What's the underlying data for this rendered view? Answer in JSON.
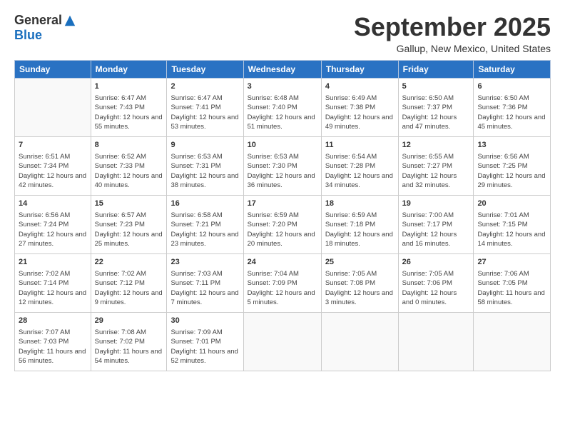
{
  "logo": {
    "general": "General",
    "blue": "Blue"
  },
  "title": "September 2025",
  "location": "Gallup, New Mexico, United States",
  "days_of_week": [
    "Sunday",
    "Monday",
    "Tuesday",
    "Wednesday",
    "Thursday",
    "Friday",
    "Saturday"
  ],
  "weeks": [
    [
      {
        "day": "",
        "sunrise": "",
        "sunset": "",
        "daylight": ""
      },
      {
        "day": "1",
        "sunrise": "Sunrise: 6:47 AM",
        "sunset": "Sunset: 7:43 PM",
        "daylight": "Daylight: 12 hours and 55 minutes."
      },
      {
        "day": "2",
        "sunrise": "Sunrise: 6:47 AM",
        "sunset": "Sunset: 7:41 PM",
        "daylight": "Daylight: 12 hours and 53 minutes."
      },
      {
        "day": "3",
        "sunrise": "Sunrise: 6:48 AM",
        "sunset": "Sunset: 7:40 PM",
        "daylight": "Daylight: 12 hours and 51 minutes."
      },
      {
        "day": "4",
        "sunrise": "Sunrise: 6:49 AM",
        "sunset": "Sunset: 7:38 PM",
        "daylight": "Daylight: 12 hours and 49 minutes."
      },
      {
        "day": "5",
        "sunrise": "Sunrise: 6:50 AM",
        "sunset": "Sunset: 7:37 PM",
        "daylight": "Daylight: 12 hours and 47 minutes."
      },
      {
        "day": "6",
        "sunrise": "Sunrise: 6:50 AM",
        "sunset": "Sunset: 7:36 PM",
        "daylight": "Daylight: 12 hours and 45 minutes."
      }
    ],
    [
      {
        "day": "7",
        "sunrise": "Sunrise: 6:51 AM",
        "sunset": "Sunset: 7:34 PM",
        "daylight": "Daylight: 12 hours and 42 minutes."
      },
      {
        "day": "8",
        "sunrise": "Sunrise: 6:52 AM",
        "sunset": "Sunset: 7:33 PM",
        "daylight": "Daylight: 12 hours and 40 minutes."
      },
      {
        "day": "9",
        "sunrise": "Sunrise: 6:53 AM",
        "sunset": "Sunset: 7:31 PM",
        "daylight": "Daylight: 12 hours and 38 minutes."
      },
      {
        "day": "10",
        "sunrise": "Sunrise: 6:53 AM",
        "sunset": "Sunset: 7:30 PM",
        "daylight": "Daylight: 12 hours and 36 minutes."
      },
      {
        "day": "11",
        "sunrise": "Sunrise: 6:54 AM",
        "sunset": "Sunset: 7:28 PM",
        "daylight": "Daylight: 12 hours and 34 minutes."
      },
      {
        "day": "12",
        "sunrise": "Sunrise: 6:55 AM",
        "sunset": "Sunset: 7:27 PM",
        "daylight": "Daylight: 12 hours and 32 minutes."
      },
      {
        "day": "13",
        "sunrise": "Sunrise: 6:56 AM",
        "sunset": "Sunset: 7:25 PM",
        "daylight": "Daylight: 12 hours and 29 minutes."
      }
    ],
    [
      {
        "day": "14",
        "sunrise": "Sunrise: 6:56 AM",
        "sunset": "Sunset: 7:24 PM",
        "daylight": "Daylight: 12 hours and 27 minutes."
      },
      {
        "day": "15",
        "sunrise": "Sunrise: 6:57 AM",
        "sunset": "Sunset: 7:23 PM",
        "daylight": "Daylight: 12 hours and 25 minutes."
      },
      {
        "day": "16",
        "sunrise": "Sunrise: 6:58 AM",
        "sunset": "Sunset: 7:21 PM",
        "daylight": "Daylight: 12 hours and 23 minutes."
      },
      {
        "day": "17",
        "sunrise": "Sunrise: 6:59 AM",
        "sunset": "Sunset: 7:20 PM",
        "daylight": "Daylight: 12 hours and 20 minutes."
      },
      {
        "day": "18",
        "sunrise": "Sunrise: 6:59 AM",
        "sunset": "Sunset: 7:18 PM",
        "daylight": "Daylight: 12 hours and 18 minutes."
      },
      {
        "day": "19",
        "sunrise": "Sunrise: 7:00 AM",
        "sunset": "Sunset: 7:17 PM",
        "daylight": "Daylight: 12 hours and 16 minutes."
      },
      {
        "day": "20",
        "sunrise": "Sunrise: 7:01 AM",
        "sunset": "Sunset: 7:15 PM",
        "daylight": "Daylight: 12 hours and 14 minutes."
      }
    ],
    [
      {
        "day": "21",
        "sunrise": "Sunrise: 7:02 AM",
        "sunset": "Sunset: 7:14 PM",
        "daylight": "Daylight: 12 hours and 12 minutes."
      },
      {
        "day": "22",
        "sunrise": "Sunrise: 7:02 AM",
        "sunset": "Sunset: 7:12 PM",
        "daylight": "Daylight: 12 hours and 9 minutes."
      },
      {
        "day": "23",
        "sunrise": "Sunrise: 7:03 AM",
        "sunset": "Sunset: 7:11 PM",
        "daylight": "Daylight: 12 hours and 7 minutes."
      },
      {
        "day": "24",
        "sunrise": "Sunrise: 7:04 AM",
        "sunset": "Sunset: 7:09 PM",
        "daylight": "Daylight: 12 hours and 5 minutes."
      },
      {
        "day": "25",
        "sunrise": "Sunrise: 7:05 AM",
        "sunset": "Sunset: 7:08 PM",
        "daylight": "Daylight: 12 hours and 3 minutes."
      },
      {
        "day": "26",
        "sunrise": "Sunrise: 7:05 AM",
        "sunset": "Sunset: 7:06 PM",
        "daylight": "Daylight: 12 hours and 0 minutes."
      },
      {
        "day": "27",
        "sunrise": "Sunrise: 7:06 AM",
        "sunset": "Sunset: 7:05 PM",
        "daylight": "Daylight: 11 hours and 58 minutes."
      }
    ],
    [
      {
        "day": "28",
        "sunrise": "Sunrise: 7:07 AM",
        "sunset": "Sunset: 7:03 PM",
        "daylight": "Daylight: 11 hours and 56 minutes."
      },
      {
        "day": "29",
        "sunrise": "Sunrise: 7:08 AM",
        "sunset": "Sunset: 7:02 PM",
        "daylight": "Daylight: 11 hours and 54 minutes."
      },
      {
        "day": "30",
        "sunrise": "Sunrise: 7:09 AM",
        "sunset": "Sunset: 7:01 PM",
        "daylight": "Daylight: 11 hours and 52 minutes."
      },
      {
        "day": "",
        "sunrise": "",
        "sunset": "",
        "daylight": ""
      },
      {
        "day": "",
        "sunrise": "",
        "sunset": "",
        "daylight": ""
      },
      {
        "day": "",
        "sunrise": "",
        "sunset": "",
        "daylight": ""
      },
      {
        "day": "",
        "sunrise": "",
        "sunset": "",
        "daylight": ""
      }
    ]
  ]
}
